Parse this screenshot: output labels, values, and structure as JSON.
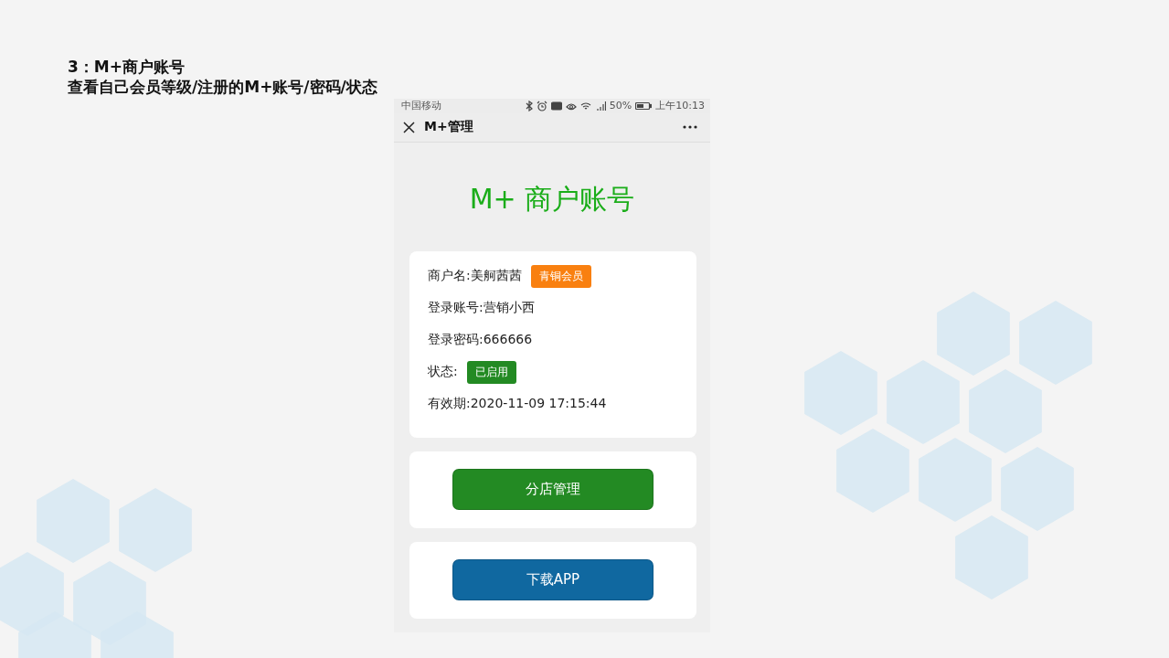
{
  "slide": {
    "heading": "3：M+商户账号",
    "subheading": "查看自己会员等级/注册的M+账号/密码/状态"
  },
  "status_bar": {
    "carrier": "中国移动",
    "battery": "50%",
    "time": "上午10:13"
  },
  "nav": {
    "title": "M+管理"
  },
  "page_title": "M+ 商户账号",
  "info": [
    {
      "text": "商户名:美舸茜茜",
      "badge": {
        "text": "青铜会员",
        "color": "#f98010"
      }
    },
    {
      "text": "登录账号:营销小西"
    },
    {
      "text": "登录密码:666666"
    },
    {
      "text": "状态:",
      "badge": {
        "text": "已启用",
        "color": "#238a23"
      }
    },
    {
      "text": "有效期:2020-11-09 17:15:44"
    }
  ],
  "buttons": [
    {
      "label": "分店管理",
      "color": "#238a23"
    },
    {
      "label": "下载APP",
      "color": "#1068a0"
    }
  ]
}
